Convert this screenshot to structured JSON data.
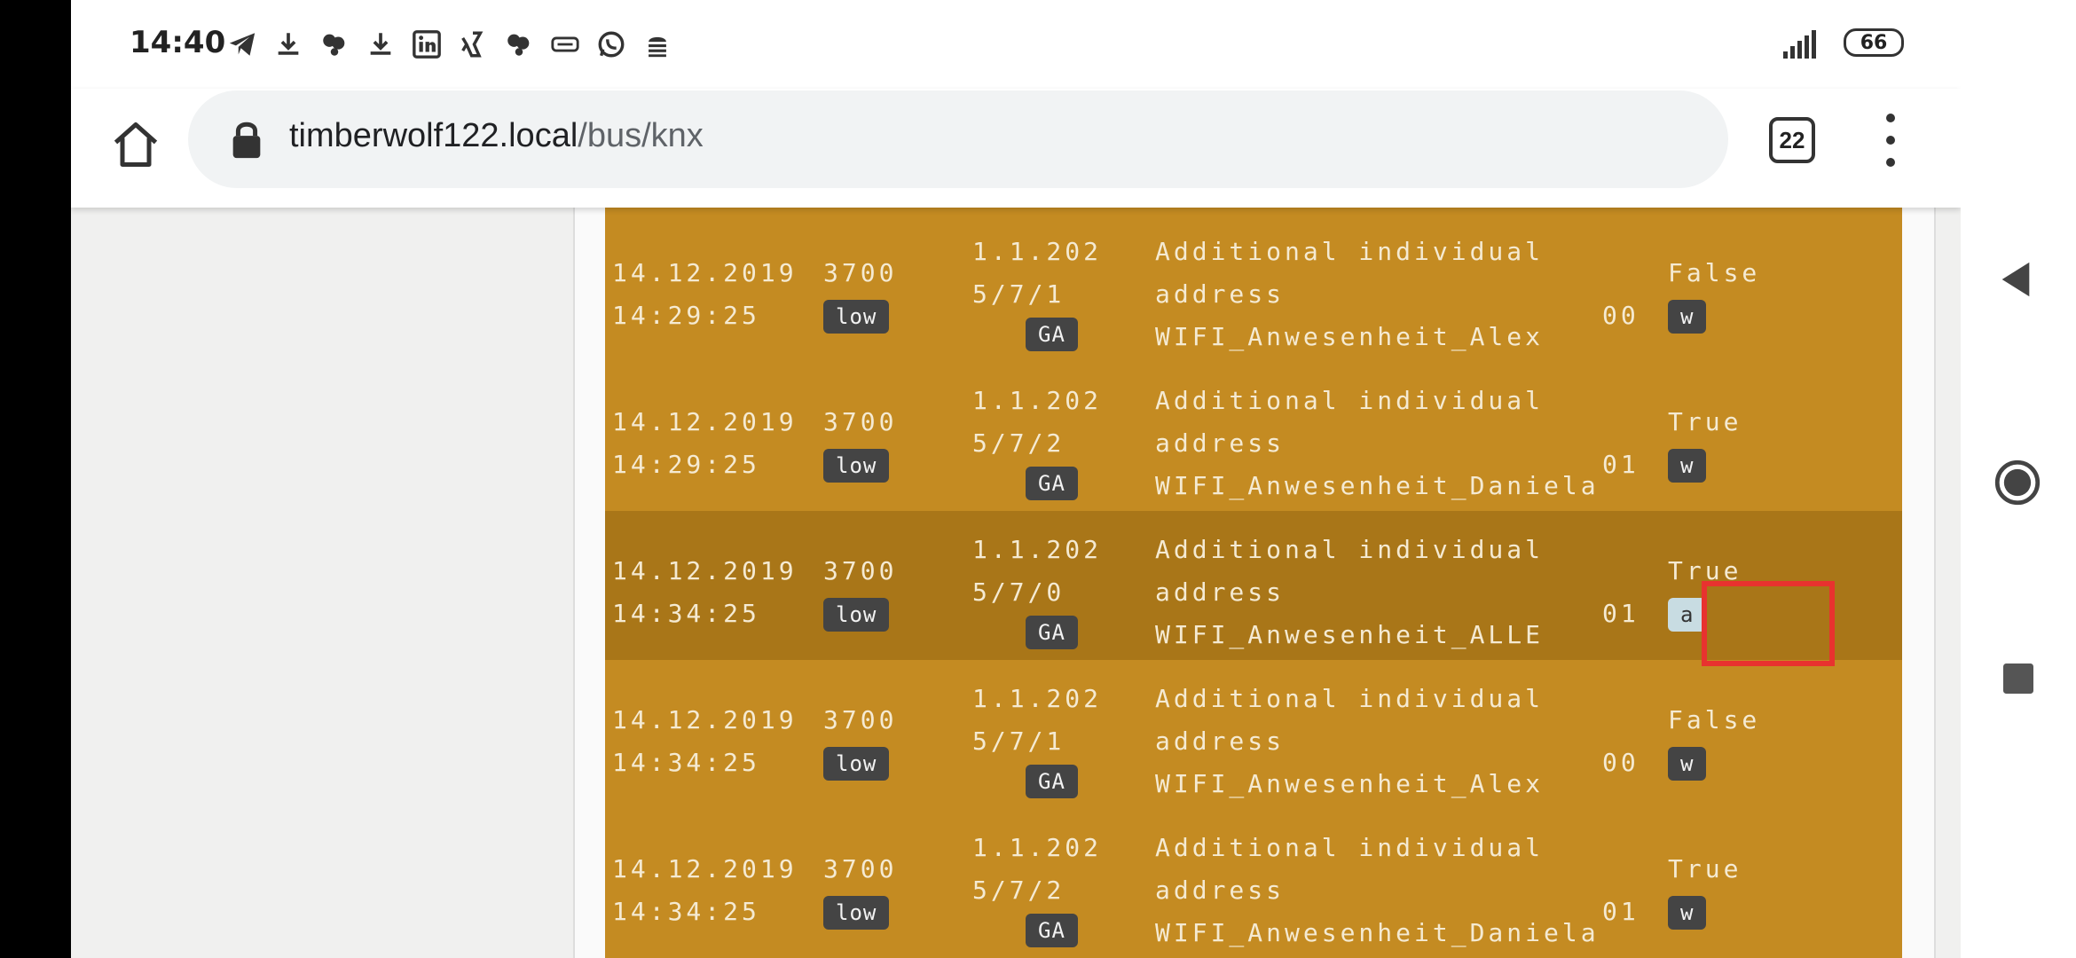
{
  "status": {
    "time": "14:40",
    "battery": "66",
    "notifications": [
      "telegram-icon",
      "download-icon",
      "heart-group-icon",
      "download-icon",
      "linkedin-icon",
      "xing-icon",
      "heart-group-icon",
      "vpn-icon",
      "whatsapp-icon",
      "android-debug-icon"
    ]
  },
  "browser": {
    "url_host": "timberwolf122.local",
    "url_path": "/bus/knx",
    "tab_count": "22"
  },
  "rows": [
    {
      "date": "14.12.2019",
      "time": "14:29:25",
      "src": "3700",
      "prio": "low",
      "ga_l1": "1.1.202",
      "ga_l2": "5/7/1",
      "ga_badge": "GA",
      "desc_l1": "Additional individual",
      "desc_l2": "address",
      "desc_l3": "WIFI_Anwesenheit_Alex",
      "raw": "00",
      "value": "False",
      "type": "w",
      "selected": false
    },
    {
      "date": "14.12.2019",
      "time": "14:29:25",
      "src": "3700",
      "prio": "low",
      "ga_l1": "1.1.202",
      "ga_l2": "5/7/2",
      "ga_badge": "GA",
      "desc_l1": "Additional individual",
      "desc_l2": "address",
      "desc_l3": "WIFI_Anwesenheit_Daniela",
      "raw": "01",
      "value": "True",
      "type": "w",
      "selected": false
    },
    {
      "date": "14.12.2019",
      "time": "14:34:25",
      "src": "3700",
      "prio": "low",
      "ga_l1": "1.1.202",
      "ga_l2": "5/7/0",
      "ga_badge": "GA",
      "desc_l1": "Additional individual",
      "desc_l2": "address",
      "desc_l3": "WIFI_Anwesenheit_ALLE",
      "raw": "01",
      "value": "True",
      "type": "a",
      "selected": true
    },
    {
      "date": "14.12.2019",
      "time": "14:34:25",
      "src": "3700",
      "prio": "low",
      "ga_l1": "1.1.202",
      "ga_l2": "5/7/1",
      "ga_badge": "GA",
      "desc_l1": "Additional individual",
      "desc_l2": "address",
      "desc_l3": "WIFI_Anwesenheit_Alex",
      "raw": "00",
      "value": "False",
      "type": "w",
      "selected": false
    },
    {
      "date": "14.12.2019",
      "time": "14:34:25",
      "src": "3700",
      "prio": "low",
      "ga_l1": "1.1.202",
      "ga_l2": "5/7/2",
      "ga_badge": "GA",
      "desc_l1": "Additional individual",
      "desc_l2": "address",
      "desc_l3": "WIFI_Anwesenheit_Daniela",
      "raw": "01",
      "value": "True",
      "type": "w",
      "selected": false
    }
  ],
  "colors": {
    "table_bg": "#c48b22",
    "selected_row": "#a97618",
    "highlight": "#e8322f"
  }
}
